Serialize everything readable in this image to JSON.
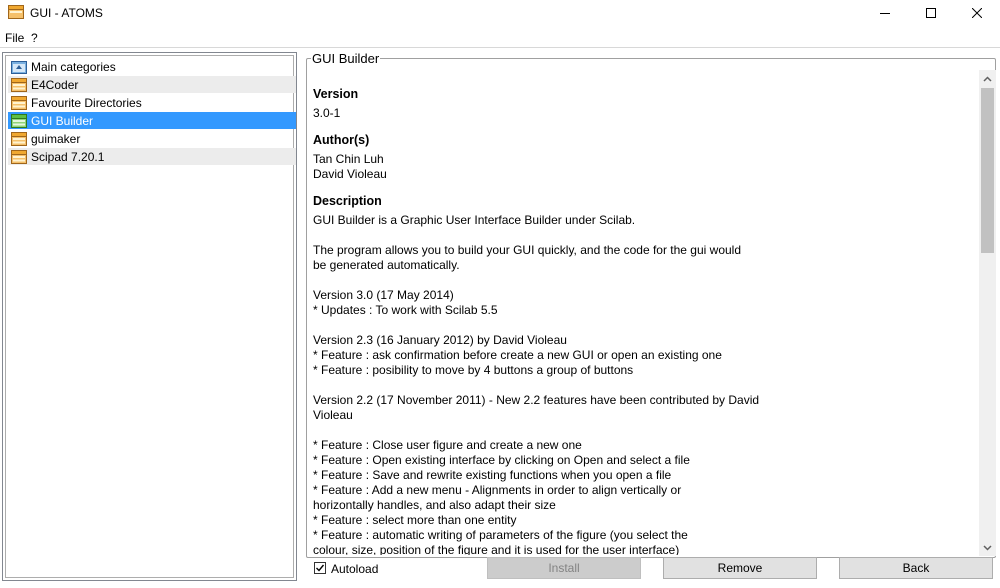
{
  "window": {
    "title": "GUI - ATOMS"
  },
  "menu": {
    "file": "File",
    "help": "?"
  },
  "modules": [
    {
      "label": "Main categories",
      "icon": "folder-up-icon",
      "selected": false
    },
    {
      "label": "E4Coder",
      "icon": "package-icon",
      "selected": false
    },
    {
      "label": "Favourite Directories",
      "icon": "package-icon",
      "selected": false
    },
    {
      "label": "GUI Builder",
      "icon": "package-installed-icon",
      "selected": true
    },
    {
      "label": "guimaker",
      "icon": "package-icon",
      "selected": false
    },
    {
      "label": "Scipad 7.20.1",
      "icon": "package-icon",
      "selected": false
    }
  ],
  "details": {
    "group_title": "GUI Builder",
    "version_heading": "Version",
    "version": "3.0-1",
    "authors_heading": "Author(s)",
    "authors": [
      "Tan Chin Luh",
      "David Violeau"
    ],
    "description_heading": "Description",
    "description_lines": [
      "GUI Builder is a Graphic User Interface Builder under Scilab.",
      "",
      "The program allows you to build your GUI quickly, and the code for the gui would",
      "be generated automatically.",
      "",
      "Version 3.0 (17 May 2014)",
      "* Updates : To work with Scilab 5.5",
      "",
      "Version 2.3 (16 January 2012) by David Violeau",
      "* Feature : ask confirmation before create a new GUI or open an existing one",
      "* Feature : posibility to move by 4 buttons a group of buttons",
      "",
      "Version 2.2 (17 November 2011) - New 2.2 features have been contributed by David",
      "Violeau",
      "",
      "* Feature : Close user figure and create a new one",
      "* Feature : Open existing interface by clicking on Open and select a file",
      "* Feature : Save and rewrite existing functions when you open a file",
      "* Feature : Add a new menu - Alignments in order to align vertically or",
      "horizontally handles, and also adapt their size",
      "* Feature : select more than one entity",
      "* Feature : automatic writing of parameters of the figure (you select the",
      "colour, size, position of the figure and it is used for the user interface)"
    ]
  },
  "bottom": {
    "autoload_label": "Autoload",
    "autoload_checked": true,
    "install_label": "Install",
    "remove_label": "Remove",
    "back_label": "Back"
  },
  "colors": {
    "selection": "#3399ff",
    "alt_row": "#ececec",
    "package_icon": "#f0a830"
  }
}
